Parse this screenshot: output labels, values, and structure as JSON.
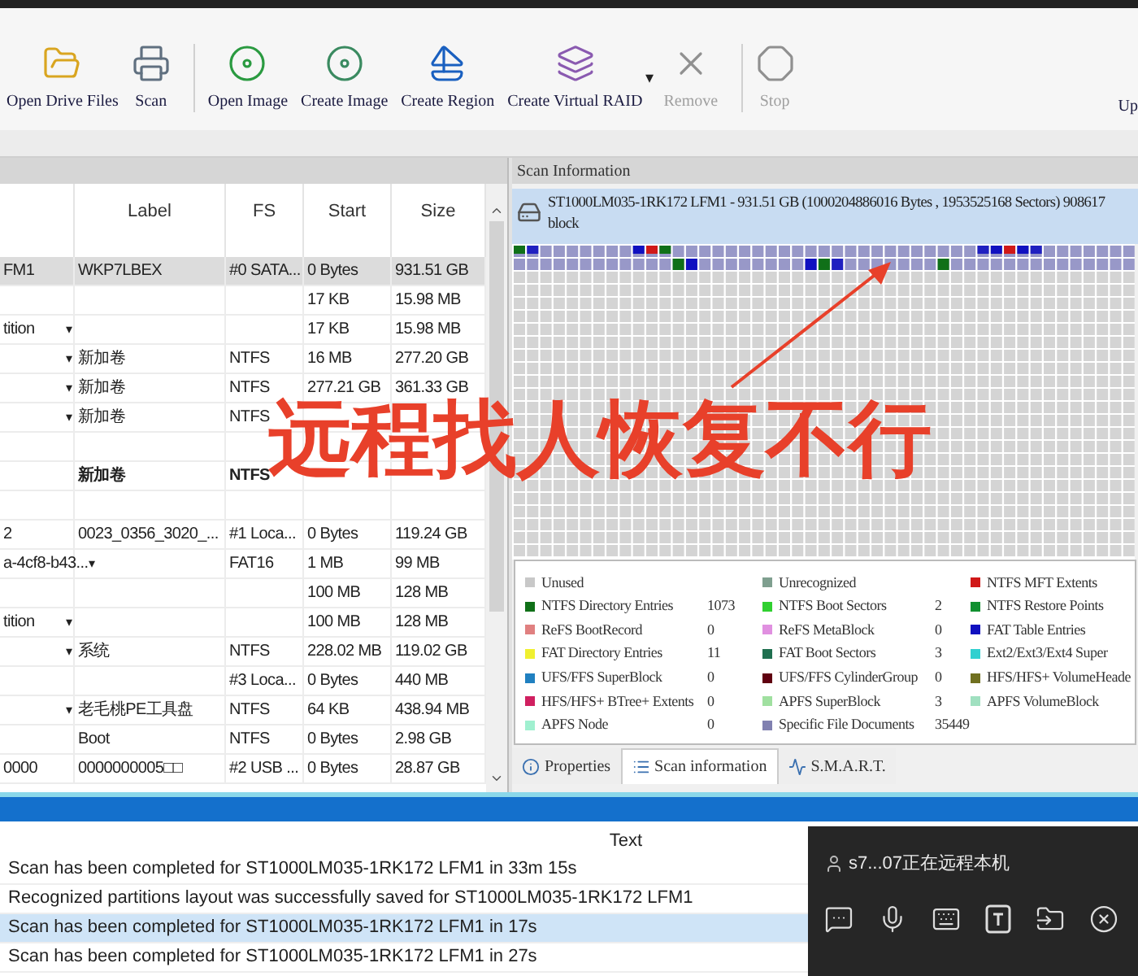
{
  "toolbar": {
    "items": [
      {
        "label": "Open Drive Files",
        "kind": "folder",
        "disabled": false
      },
      {
        "label": "Scan",
        "kind": "scanner",
        "disabled": false
      },
      {
        "label": "Open Image",
        "kind": "open-disc",
        "disabled": false
      },
      {
        "label": "Create Image",
        "kind": "create-disc",
        "disabled": false
      },
      {
        "label": "Create Region",
        "kind": "region",
        "disabled": false
      },
      {
        "label": "Create Virtual RAID",
        "kind": "raid",
        "disabled": false,
        "menu_arrow": "▾"
      },
      {
        "label": "Remove",
        "kind": "remove",
        "disabled": true
      },
      {
        "label": "Stop",
        "kind": "stop",
        "disabled": true
      }
    ],
    "cut_label": "Up"
  },
  "drive_table": {
    "columns": [
      null,
      "Label",
      "FS",
      "Start",
      "Size"
    ],
    "rows": [
      {
        "cells": [
          "FM1",
          "WKP7LBEX",
          "#0 SATA...",
          "0 Bytes",
          "931.51 GB"
        ],
        "selected": true,
        "bold": false
      },
      {
        "cells": [
          null,
          null,
          null,
          "17 KB",
          "15.98 MB"
        ],
        "selected": false,
        "bold": false
      },
      {
        "cells": [
          "tition",
          null,
          null,
          "17 KB",
          "15.98 MB"
        ],
        "dropdown": "▾",
        "selected": false,
        "bold": false
      },
      {
        "cells": [
          null,
          "新加卷",
          "NTFS",
          "16 MB",
          "277.20 GB"
        ],
        "dropdown": "▾",
        "selected": false,
        "bold": false
      },
      {
        "cells": [
          null,
          "新加卷",
          "NTFS",
          "277.21 GB",
          "361.33 GB"
        ],
        "dropdown": "▾",
        "selected": false,
        "bold": false
      },
      {
        "cells": [
          null,
          "新加卷",
          "NTFS",
          null,
          null
        ],
        "dropdown": "▾",
        "selected": false,
        "bold": false
      },
      {
        "cells": [
          null,
          null,
          null,
          null,
          null
        ],
        "selected": false
      },
      {
        "cells": [
          null,
          "新加卷",
          "NTFS",
          null,
          null
        ],
        "selected": false,
        "bold": true
      },
      {
        "cells": [
          null,
          null,
          null,
          null,
          null
        ],
        "selected": false
      },
      {
        "cells": [
          "2",
          "0023_0356_3020_...",
          "#1 Loca...",
          "0 Bytes",
          "119.24 GB"
        ],
        "selected": false,
        "bold": false
      },
      {
        "cells": [
          "a-4cf8-b43...",
          null,
          "FAT16",
          "1 MB",
          "99 MB"
        ],
        "dropdown": "▾",
        "selected": false,
        "bold": false
      },
      {
        "cells": [
          null,
          null,
          null,
          "100 MB",
          "128 MB"
        ],
        "selected": false,
        "bold": false
      },
      {
        "cells": [
          "tition",
          null,
          null,
          "100 MB",
          "128 MB"
        ],
        "dropdown": "▾",
        "selected": false,
        "bold": false
      },
      {
        "cells": [
          null,
          "系统",
          "NTFS",
          "228.02 MB",
          "119.02 GB"
        ],
        "dropdown": "▾",
        "selected": false,
        "bold": false
      },
      {
        "cells": [
          null,
          null,
          "#3 Loca...",
          "0 Bytes",
          "440 MB"
        ],
        "selected": false,
        "bold": false
      },
      {
        "cells": [
          null,
          "老毛桃PE工具盘",
          "NTFS",
          "64 KB",
          "438.94 MB"
        ],
        "dropdown": "▾",
        "selected": false,
        "bold": false
      },
      {
        "cells": [
          null,
          "Boot",
          "NTFS",
          "0 Bytes",
          "2.98 GB"
        ],
        "selected": false,
        "bold": false
      },
      {
        "cells": [
          "0000",
          "0000000005□□",
          "#2 USB ...",
          "0 Bytes",
          "28.87 GB"
        ],
        "selected": false,
        "bold": false
      }
    ]
  },
  "scan_panel": {
    "title": "Scan Information",
    "disk_line_1": "ST1000LM035-1RK172 LFM1 - 931.51 GB (1000204886016 Bytes , 1953525168 Sectors) 908617",
    "disk_line_2": "block",
    "legend": [
      {
        "label": "Unused",
        "color": "#c8c8c8"
      },
      {
        "label": "Unrecognized",
        "color": "#7f9f8f"
      },
      {
        "label": "NTFS MFT Extents",
        "color": "#d01818"
      },
      {
        "label": "NTFS Directory Entries",
        "count": "1073",
        "color": "#107018"
      },
      {
        "label": "NTFS Boot Sectors",
        "count": "2",
        "color": "#30d030"
      },
      {
        "label": "NTFS Restore Points",
        "color": "#109030"
      },
      {
        "label": "ReFS BootRecord",
        "count": "0",
        "color": "#e08080"
      },
      {
        "label": "ReFS MetaBlock",
        "count": "0",
        "color": "#e090e0"
      },
      {
        "label": "FAT Table Entries",
        "color": "#1010c0"
      },
      {
        "label": "FAT Directory Entries",
        "count": "11",
        "color": "#f0f030"
      },
      {
        "label": "FAT Boot Sectors",
        "count": "3",
        "color": "#207050"
      },
      {
        "label": "Ext2/Ext3/Ext4 Super",
        "color": "#30d0d0"
      },
      {
        "label": "UFS/FFS SuperBlock",
        "count": "0",
        "color": "#2080c0"
      },
      {
        "label": "UFS/FFS CylinderGroup",
        "count": "0",
        "color": "#600010"
      },
      {
        "label": "HFS/HFS+ VolumeHeade",
        "color": "#707020"
      },
      {
        "label": "HFS/HFS+ BTree+ Extents",
        "count": "0",
        "color": "#d02060"
      },
      {
        "label": "APFS SuperBlock",
        "count": "3",
        "color": "#a0e0a0"
      },
      {
        "label": "APFS VolumeBlock",
        "color": "#a0e0c0"
      },
      {
        "label": "APFS Node",
        "count": "0",
        "color": "#a0f0d0"
      },
      {
        "label": "Specific File Documents",
        "count": "35449",
        "color": "#8080b0"
      }
    ],
    "tabs": [
      {
        "label": "Properties",
        "selected": false
      },
      {
        "label": "Scan information",
        "selected": true
      },
      {
        "label": "S.M.A.R.T.",
        "selected": false
      }
    ]
  },
  "log": {
    "column": "Text",
    "rows": [
      {
        "text": "Scan has been completed for ST1000LM035-1RK172 LFM1 in 33m 15s",
        "selected": false
      },
      {
        "text": "Recognized partitions layout was successfully saved for ST1000LM035-1RK172 LFM1",
        "selected": false
      },
      {
        "text": "Scan has been completed for ST1000LM035-1RK172 LFM1 in 17s",
        "selected": true
      },
      {
        "text": "Scan has been completed for ST1000LM035-1RK172 LFM1 in 27s",
        "selected": false
      }
    ]
  },
  "remote_panel": {
    "status": "s7...07正在远程本机"
  },
  "annotation": {
    "caption": "远程找人恢复不行"
  }
}
